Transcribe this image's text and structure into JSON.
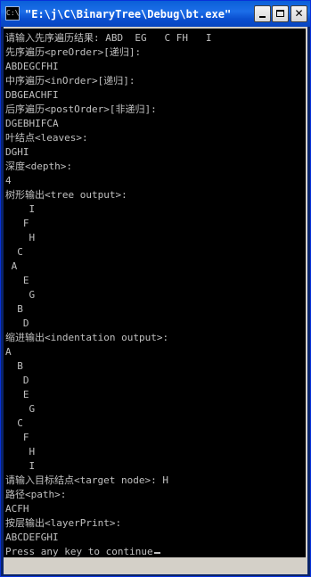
{
  "window": {
    "title": "\"E:\\j\\C\\BinaryTree\\Debug\\bt.exe\"",
    "icon_label": "C:\\"
  },
  "console": {
    "lines": [
      "请输入先序遍历结果: ABD  EG   C FH   I",
      "先序遍历<preOrder>[递归]:",
      "ABDEGCFHI",
      "中序遍历<inOrder>[递归]:",
      "DBGEACHFI",
      "后序遍历<postOrder>[非递归]:",
      "DGEBHIFCA",
      "叶结点<leaves>:",
      "DGHI",
      "深度<depth>:",
      "4",
      "树形输出<tree output>:",
      "    I",
      "   F",
      "    H",
      "  C",
      " A",
      "   E",
      "    G",
      "  B",
      "   D",
      "缩进输出<indentation output>:",
      "A",
      "  B",
      "   D",
      "   E",
      "    G",
      "  C",
      "   F",
      "    H",
      "    I",
      "请输入目标结点<target node>: H",
      "路径<path>:",
      "ACFH",
      "按层输出<layerPrint>:",
      "ABCDEFGHI",
      "Press any key to continue"
    ]
  }
}
